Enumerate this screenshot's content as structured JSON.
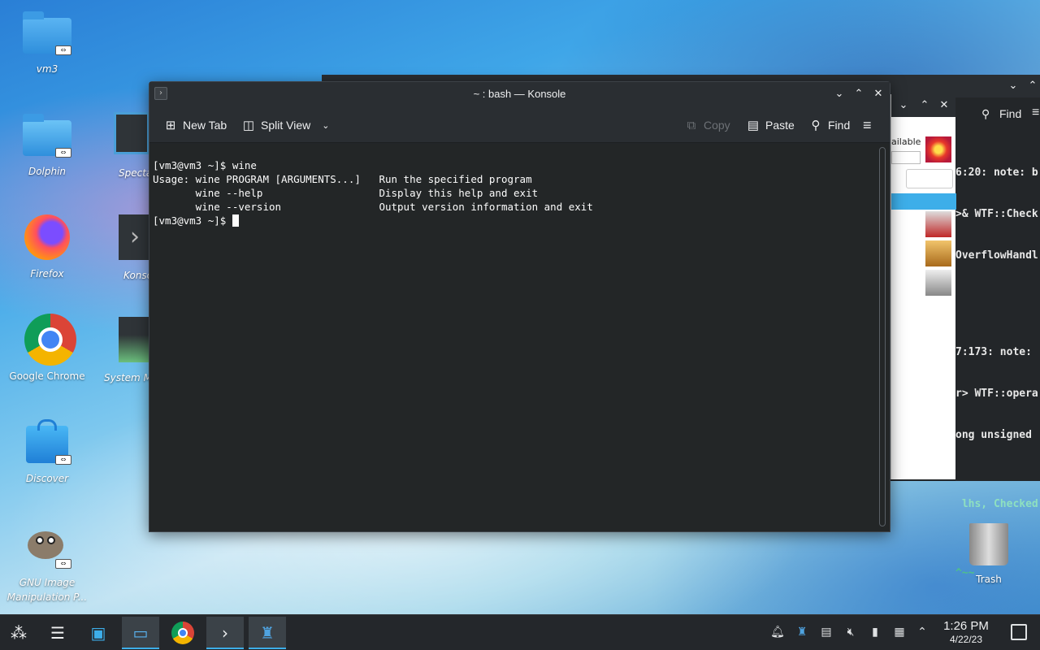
{
  "desktop": {
    "icons": [
      {
        "label": "vm3"
      },
      {
        "label": "Dolphin"
      },
      {
        "label": "Firefox"
      },
      {
        "label": "Google Chrome"
      },
      {
        "label": "Discover"
      },
      {
        "label": "GNU Image Manipulation P..."
      },
      {
        "label": "Specta"
      },
      {
        "label": "Konso"
      },
      {
        "label": "System M"
      },
      {
        "label": "Trash"
      }
    ]
  },
  "background_window": {
    "toolbar": {
      "find_label": "Find"
    },
    "dialog_text": "ailable",
    "code_lines": [
      "6:20: note: b",
      ">& WTF::Check",
      "OverflowHandl",
      "",
      "",
      "7:173: note:",
      "r> WTF::opera",
      "ong unsigned",
      "",
      " lhs, Checked",
      "",
      "^~~"
    ]
  },
  "konsole": {
    "title": "~ : bash — Konsole",
    "toolbar": {
      "new_tab": "New Tab",
      "split_view": "Split View",
      "copy": "Copy",
      "paste": "Paste",
      "find": "Find"
    },
    "terminal_lines": [
      "[vm3@vm3 ~]$ wine",
      "Usage: wine PROGRAM [ARGUMENTS...]   Run the specified program",
      "       wine --help                   Display this help and exit",
      "       wine --version                Output version information and exit"
    ],
    "prompt": "[vm3@vm3 ~]$ "
  },
  "taskbar": {
    "clock_time": "1:26 PM",
    "clock_date": "4/22/23"
  }
}
